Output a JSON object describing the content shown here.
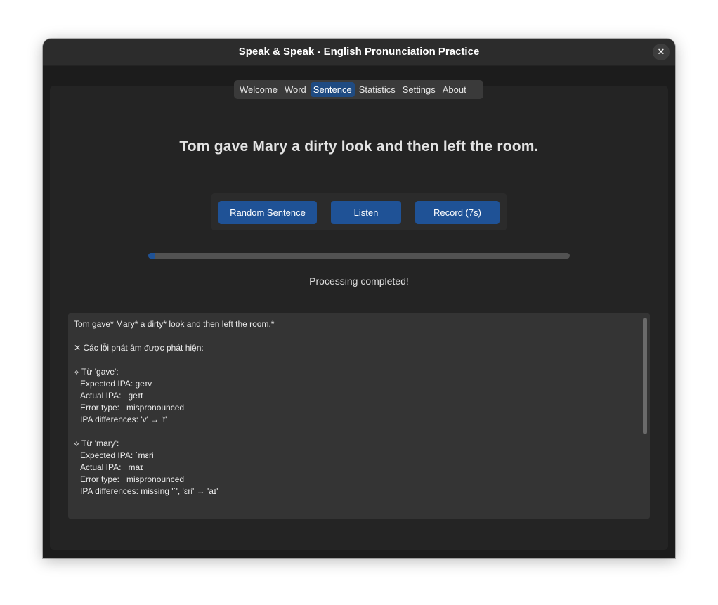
{
  "window": {
    "title": "Speak & Speak - English Pronunciation Practice",
    "close_symbol": "✕"
  },
  "tabs": [
    {
      "label": "Welcome"
    },
    {
      "label": "Word"
    },
    {
      "label": "Sentence",
      "active": true
    },
    {
      "label": "Statistics"
    },
    {
      "label": "Settings"
    },
    {
      "label": "About"
    }
  ],
  "sentence": "Tom gave Mary a dirty look and then left the room.",
  "buttons": {
    "random": "Random Sentence",
    "listen": "Listen",
    "record": "Record (7s)"
  },
  "progress": {
    "fraction": 0.015
  },
  "status": "Processing completed!",
  "result": {
    "header": "Tom gave* Mary* a dirty* look and then left the room.*",
    "errors_title": "✕ Các lỗi phát âm được phát hiện:",
    "words": [
      {
        "heading": "⟡ Từ 'gave':",
        "expected": "Expected IPA: geɪv",
        "actual": "Actual IPA:   geɪt",
        "type": "Error type:   mispronounced",
        "diff": "IPA differences: 'v' → 't'"
      },
      {
        "heading": "⟡ Từ 'mary':",
        "expected": "Expected IPA: ˈmɛri",
        "actual": "Actual IPA:   maɪ",
        "type": "Error type:   mispronounced",
        "diff": "IPA differences: missing 'ˈ', 'ɛri' → 'aɪ'"
      }
    ]
  },
  "colors": {
    "accent": "#1f5296",
    "active_tab": "#1f4b82",
    "window_bg": "#1c1c1c",
    "panel_bg": "#242424",
    "result_bg": "#343434"
  }
}
